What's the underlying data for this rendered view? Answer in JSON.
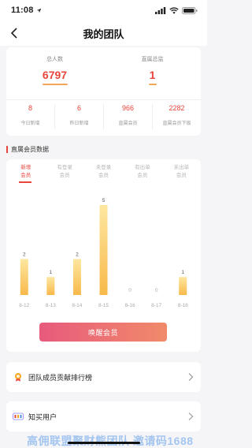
{
  "status": {
    "time": "11:08"
  },
  "nav": {
    "title": "我的团队"
  },
  "stats": {
    "total_label": "总人数",
    "total_value": "6797",
    "director_label": "直属总监",
    "director_value": "1",
    "small": [
      {
        "value": "8",
        "label": "今日新增"
      },
      {
        "value": "6",
        "label": "昨日新增"
      },
      {
        "value": "966",
        "label": "直属会员"
      },
      {
        "value": "2282",
        "label": "直属会员下级"
      }
    ]
  },
  "section": {
    "title": "直属会员数据"
  },
  "tabs": [
    {
      "line1": "新增",
      "line2": "会员",
      "active": true
    },
    {
      "line1": "有登录",
      "line2": "会员",
      "active": false
    },
    {
      "line1": "未登录",
      "line2": "会员",
      "active": false
    },
    {
      "line1": "有出单",
      "line2": "会员",
      "active": false
    },
    {
      "line1": "未出单",
      "line2": "会员",
      "active": false
    }
  ],
  "chart_data": {
    "type": "bar",
    "categories": [
      "8-12",
      "8-13",
      "8-14",
      "8-15",
      "8-16",
      "8-17",
      "8-18"
    ],
    "values": [
      2,
      1,
      2,
      5,
      0,
      0,
      1
    ],
    "ylim": [
      0,
      5
    ],
    "grid": false,
    "bar_colors": [
      "#fde7a0",
      "#f8b94a"
    ]
  },
  "wake_button": {
    "label": "唤醒会员"
  },
  "rows": [
    {
      "label": "团队成员贡献排行榜",
      "icon": "medal-icon"
    },
    {
      "label": "知买用户",
      "icon": "user-tag-icon"
    }
  ],
  "watermark": "高佣联盟聚财熊团队 邀请码1688",
  "colors": {
    "accent": "#e8453c",
    "underline": "#f2a65a"
  }
}
